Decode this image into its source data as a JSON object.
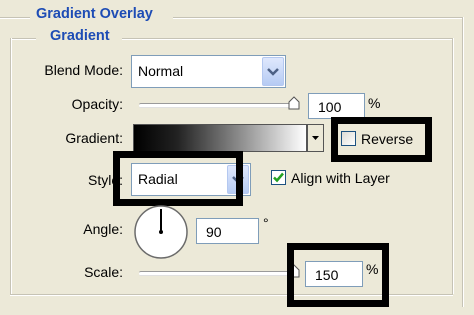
{
  "group": {
    "title": "Gradient Overlay",
    "subtitle": "Gradient"
  },
  "blend_mode": {
    "label": "Blend Mode:",
    "value": "Normal"
  },
  "opacity": {
    "label": "Opacity:",
    "value": "100",
    "unit": "%",
    "slider_fraction": 1.0
  },
  "gradient": {
    "label": "Gradient:",
    "colors": [
      "#000000",
      "#ffffff"
    ]
  },
  "reverse": {
    "label": "Reverse",
    "checked": false
  },
  "style": {
    "label": "Style:",
    "value": "Radial"
  },
  "align_with_layer": {
    "label": "Align with Layer",
    "checked": true
  },
  "angle": {
    "label": "Angle:",
    "value": "90",
    "unit": "°"
  },
  "scale": {
    "label": "Scale:",
    "value": "150",
    "unit": "%",
    "slider_fraction": 1.0
  },
  "colors": {
    "panel_bg": "#ece9d8",
    "title_blue": "#1d4cb5",
    "field_border": "#7f9db9",
    "checkmark_green": "#21a121",
    "highlight_box": "#000000"
  },
  "icons": {
    "dropdown": "chevron-down-icon",
    "checkbox": "check-icon",
    "angle_dial": "angle-dial-icon",
    "slider_thumb": "slider-thumb-icon"
  }
}
